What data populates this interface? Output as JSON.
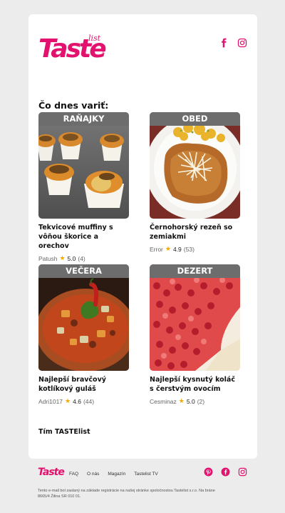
{
  "brand": {
    "logo_text": "Taste",
    "logo_sup": "list",
    "logo_reg": "®"
  },
  "heading": "Čo dnes variť:",
  "recipes": [
    {
      "category": "RAŇAJKY",
      "title": "Tekvicové muffiny s vôňou škorice a orechov",
      "author": "Patush",
      "rating": "5.0",
      "count": "(4)"
    },
    {
      "category": "OBED",
      "title": "Černohorský rezeň so zemiakmi",
      "author": "Error",
      "rating": "4.9",
      "count": "(53)"
    },
    {
      "category": "VEČERA",
      "title": "Najlepší bravčový kotlíkový guláš",
      "author": "Adri1017",
      "rating": "4.6",
      "count": "(44)"
    },
    {
      "category": "DEZERT",
      "title": "Najlepší kysnutý koláč s čerstvým ovocím",
      "author": "Cesminaz",
      "rating": "5.0",
      "count": "(2)"
    }
  ],
  "signature": "Tím TASTElist",
  "footer": {
    "logo_text": "Taste",
    "nav": [
      "FAQ",
      "O nás",
      "Magazín",
      "Tastelist TV"
    ],
    "legal": "Tento e-mail bol zaslaný na základe registrácie na našej stránke spoločnostou Tastelist s.r.o. Na bráne 8665/4 Žilina SR 010 01."
  },
  "icons": {
    "top": [
      "facebook-icon",
      "instagram-icon"
    ],
    "bottom": [
      "pinterest-icon",
      "facebook-icon",
      "instagram-icon"
    ]
  },
  "colors": {
    "brand": "#e2126e",
    "category_bar": "#6d6d6d",
    "star": "#f2a900",
    "background": "#ececec"
  }
}
